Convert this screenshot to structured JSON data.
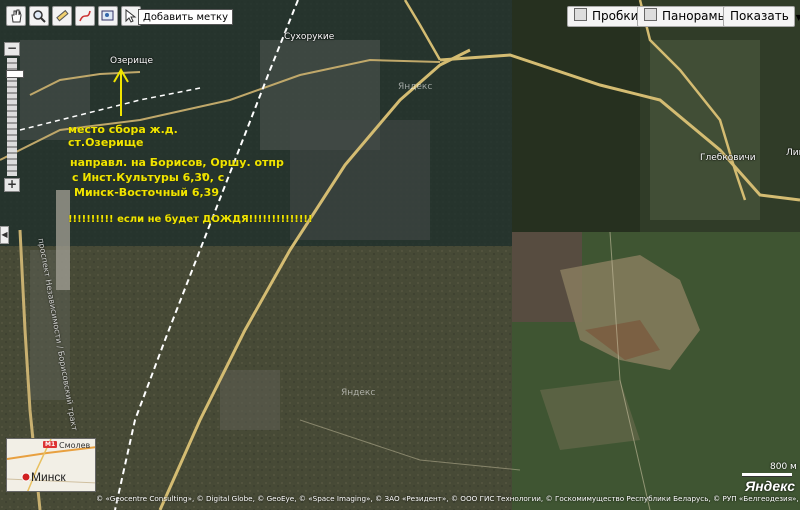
{
  "toolbar": {
    "add_label_tooltip": "Добавить метку"
  },
  "top_right": {
    "traffic": "Пробки",
    "panoramas": "Панорамы",
    "show": "Показать"
  },
  "map_labels": {
    "ozerishche": "Озерище",
    "sukhorukie": "Сухорукие",
    "glebkovichi": "Глебковичи",
    "lip": "Лип",
    "road_vertical": "проспект Независимости / Борисовский тракт"
  },
  "watermarks": {
    "top": "Яндекс",
    "bottom": "Яндекс"
  },
  "annotations": {
    "meeting_line1": "место сбора ж.д.",
    "meeting_line2": "ст.Озерище",
    "direction_line1": "направл. на Борисов, Оршу.    отпр",
    "direction_line2": "с Инст.Культуры 6,30,   с",
    "direction_line3": "Минск-Восточный 6,39",
    "weather_line": "!!!!!!!!!! если не будет ДОЖДЯ!!!!!!!!!!!!!!"
  },
  "minimap": {
    "city": "Минск",
    "suburb": "Смолев",
    "road": "M1"
  },
  "footer": {
    "copyright": "© «Geocentre Consulting», © Digital Globe, © GeoEye, © «Space Imaging», © ЗАО «Резидент», © ООО ГИС Технологии, © Госкомимущество Республики Беларусь, © РУП «Белгеодезия», © ЗАО «ТГА», 2006, © ВТУ ГШ ВС РФ, Пользовательское соглашение",
    "scale": "800 м",
    "logo": "Яндекс"
  },
  "colors": {
    "road": "#f0d78a",
    "annotation": "#f0e400",
    "railway": "#ffffff"
  }
}
